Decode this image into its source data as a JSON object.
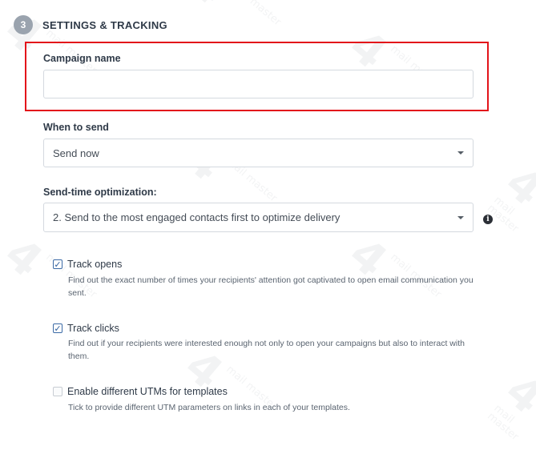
{
  "section": {
    "step_number": "3",
    "title": "SETTINGS & TRACKING"
  },
  "campaign_name": {
    "label": "Campaign name",
    "value": "",
    "placeholder": ""
  },
  "when_to_send": {
    "label": "When to send",
    "selected": "Send now"
  },
  "send_time_optimization": {
    "label": "Send-time optimization:",
    "selected": "2. Send to the most engaged contacts first to optimize delivery",
    "info_icon": "info-circle-icon"
  },
  "track_opens": {
    "checked": true,
    "label": "Track opens",
    "description": "Find out the exact number of times your recipients' attention got captivated to open email communication you sent."
  },
  "track_clicks": {
    "checked": true,
    "label": "Track clicks",
    "description": "Find out if your recipients were interested enough not only to open your campaigns but also to interact with them."
  },
  "enable_utms": {
    "checked": false,
    "label": "Enable different UTMs for templates",
    "description": "Tick to provide different UTM parameters on links in each of your templates."
  },
  "watermark": {
    "mark": "4",
    "text": "mail master"
  },
  "colors": {
    "highlight_border": "#e3131a",
    "step_circle": "#9aa3ae",
    "checkbox_check": "#2e5f9e"
  }
}
